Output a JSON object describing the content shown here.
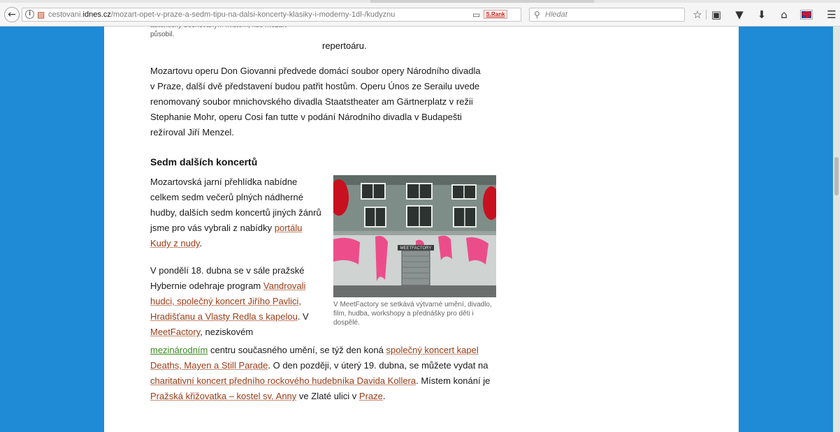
{
  "browser": {
    "url_prefix": "cestovani.",
    "url_domain": "idnes.cz",
    "url_path": "/mozart-opet-v-praze-a-sedm-tipu-na-dalsi-koncerty-klasiky-i-moderny-1dl-/kudyznu",
    "srank_label": "S.Rank",
    "search_placeholder": "Hledat",
    "icons": {
      "back": "back-arrow-icon",
      "info": "info-icon",
      "lock": "lock-icon",
      "reader": "reader-view-icon",
      "reload": "reload-icon",
      "search": "search-icon",
      "bookmark": "bookmark-star-icon",
      "library": "library-icon",
      "pocket": "pocket-icon",
      "download": "download-icon",
      "home": "home-icon",
      "flag": "flag-icon",
      "menu": "hamburger-menu-icon"
    }
  },
  "colors": {
    "page_background": "#1f8ad6",
    "link": "#9a3b16",
    "link_green": "#3b8a1e"
  },
  "article": {
    "top_caption": "autentický dochovaným místem, kde Mozart působil.",
    "top_fragment": "repertoáru.",
    "paragraph1": "Mozartovu operu Don Giovanni předvede domácí soubor opery Národního divadla v Praze, další dvě představení budou patřit hostům. Operu Únos ze Serailu uvede renomovaný soubor mnichovského divadla Staatstheater am Gärtnerplatz v režii Stephanie Mohr, operu Cosi fan tutte v podání Národního divadla v Budapešti režíroval Jiří Menzel.",
    "heading": "Sedm dalších koncertů",
    "paragraph2_text": "Mozartovská jarní přehlídka nabídne celkem sedm večerů plných nádherné hudby, dalších sedm koncertů jiných žánrů jsme pro vás vybrali z nabídky",
    "paragraph2_link": "portálu Kudy z nudy",
    "paragraph2_end": ".",
    "paragraph3_text1": "V pondělí 18. dubna se v sále pražské Hybernie odehraje program",
    "paragraph3_link1": "Vandrovali hudci, společný koncert Jiřího Pavlici, Hradišťanu a Vlasty Redla s kapelou",
    "paragraph3_text2": ". V",
    "paragraph3_link2": "MeetFactory",
    "paragraph3_text3": ", neziskovém",
    "paragraph4_link_green": "mezinárodním",
    "paragraph4_text1": "centru současného umění, se týž den koná",
    "paragraph4_link1": "společný koncert kapel Deaths, Mayen a Still Parade",
    "paragraph4_text2": ". O den později, v úterý 19. dubna, se můžete vydat na",
    "paragraph4_link2": "charitativní koncert předního rockového hudebníka Davida Kollera",
    "paragraph4_text3": ". Místem konání je",
    "paragraph4_link3": "Pražská křižovatka – kostel sv. Anny",
    "paragraph4_text4": "ve Zlaté ulici v",
    "paragraph4_link4": "Praze",
    "paragraph4_end": ".",
    "photo_sign": "MEETFACTORY",
    "photo_caption": "V MeetFactory se setkává výtvarné umění, divadlo, film, hudba, workshopy a přednášky pro děti i dospělé."
  }
}
